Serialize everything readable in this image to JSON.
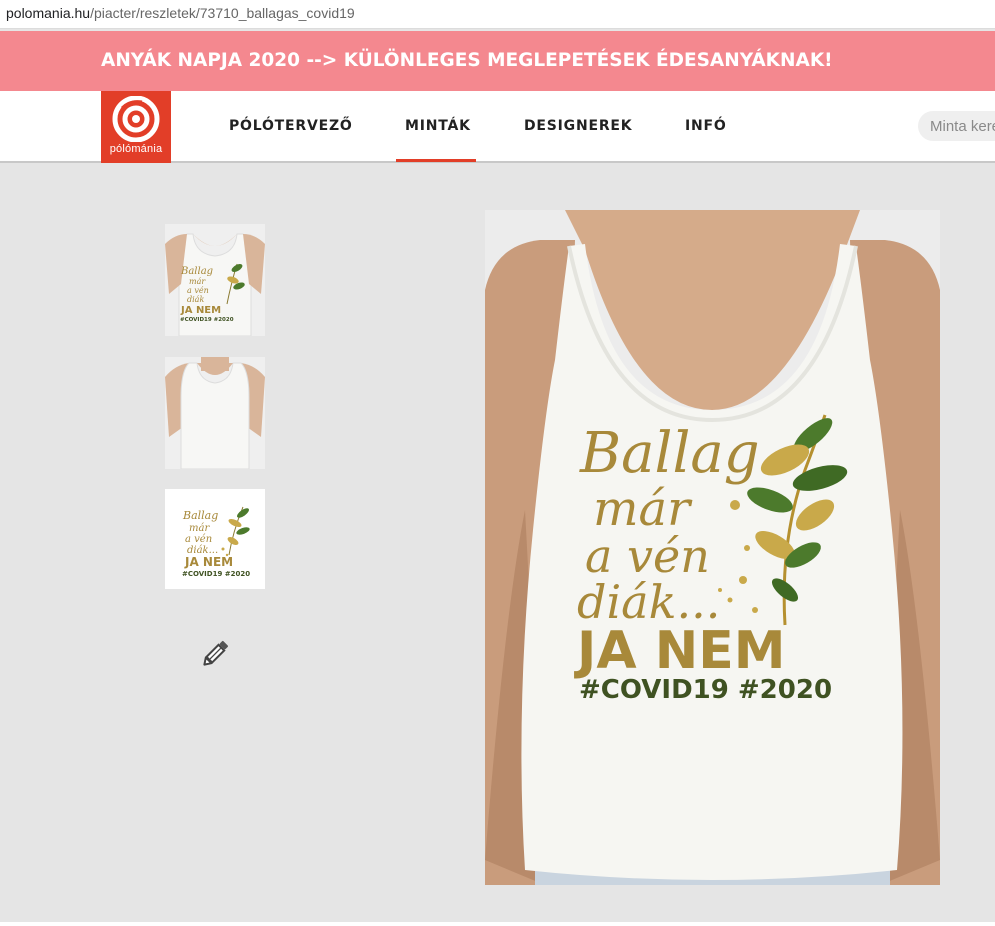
{
  "browser": {
    "url_host": "polomania.hu",
    "url_path": "/piacter/reszletek/73710_ballagas_covid19"
  },
  "promo": {
    "text": "ANYÁK NAPJA 2020 --> KÜLÖNLEGES MEGLEPETÉSEK ÉDESANYÁKNAK!",
    "color": "#f4888f"
  },
  "header": {
    "logo_text": "pólómánia",
    "brand_color": "#e23e28",
    "nav": [
      {
        "label": "PÓLÓTERVEZŐ",
        "active": false
      },
      {
        "label": "MINTÁK",
        "active": true
      },
      {
        "label": "DESIGNEREK",
        "active": false
      },
      {
        "label": "INFÓ",
        "active": false
      }
    ],
    "search_placeholder": "Minta keresése"
  },
  "design": {
    "line1": "Ballag",
    "line2": "már",
    "line3": "a vén",
    "line4": "diák...",
    "line5": "JA NEM",
    "line6": "#COVID19 #2020",
    "gold": "#a8893a",
    "green": "#3f5222"
  },
  "icons": {
    "edit": "pencil-icon"
  }
}
